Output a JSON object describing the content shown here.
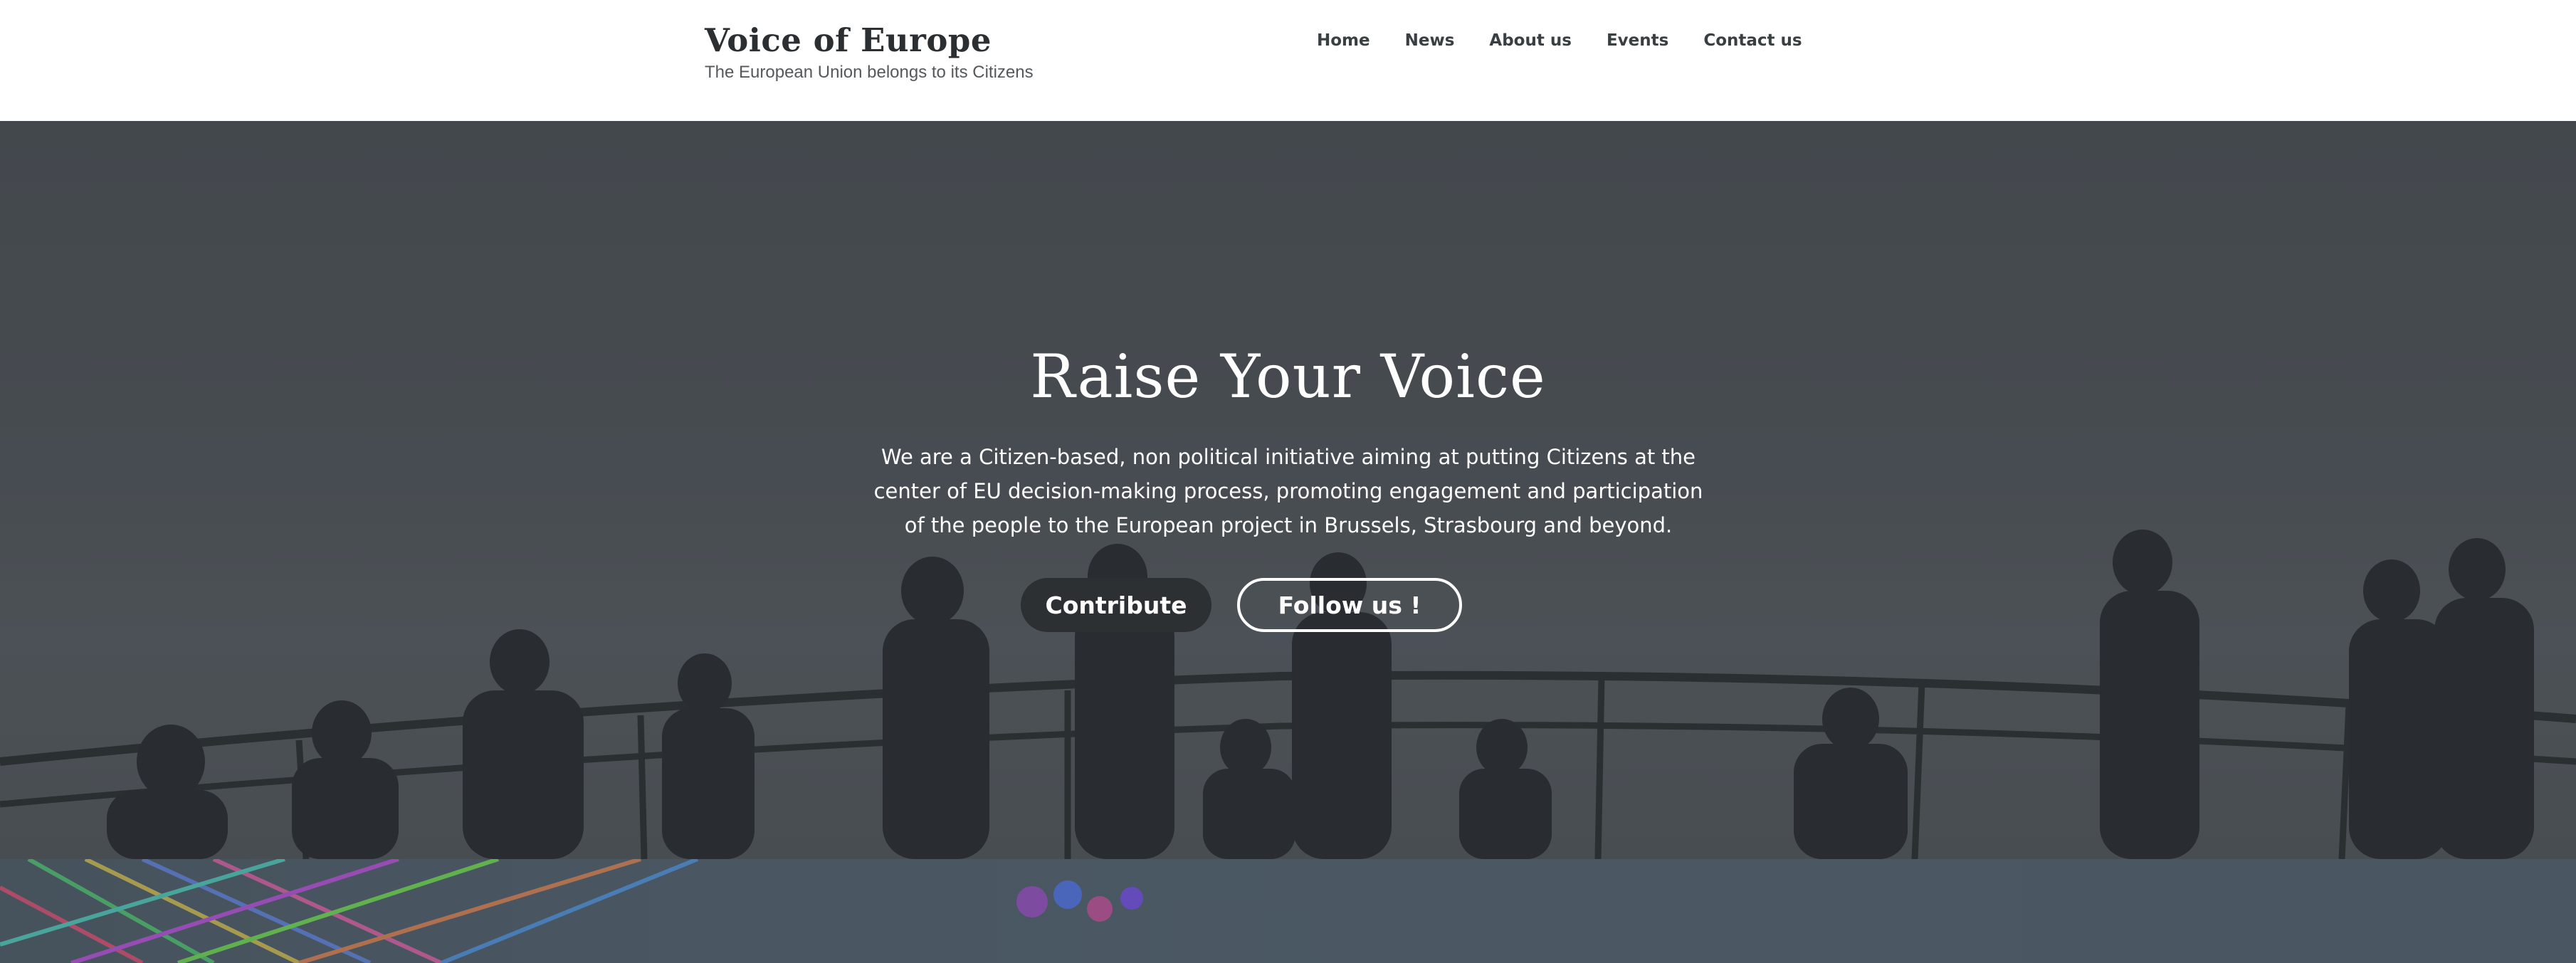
{
  "site": {
    "title": "Voice of Europe",
    "tagline": "The European Union belongs to its Citizens"
  },
  "nav": {
    "items": [
      {
        "label": "Home"
      },
      {
        "label": "News"
      },
      {
        "label": "About us"
      },
      {
        "label": "Events"
      },
      {
        "label": "Contact us"
      }
    ]
  },
  "hero": {
    "title": "Raise Your Voice",
    "text_lines": [
      "We are a Citizen-based, non political initiative aiming at putting Citizens at the",
      "center of EU decision-making process, promoting engagement and participation",
      "of the people to the European project in Brussels, Strasbourg and beyond."
    ],
    "primary_button": "Contribute",
    "secondary_button": "Follow us !"
  },
  "colors": {
    "header_bg": "#ffffff",
    "hero_bg": "#4d5257",
    "contribute_button_bg": "#2d3033",
    "text_light": "#ffffff",
    "text_dark": "#2b2f32"
  }
}
